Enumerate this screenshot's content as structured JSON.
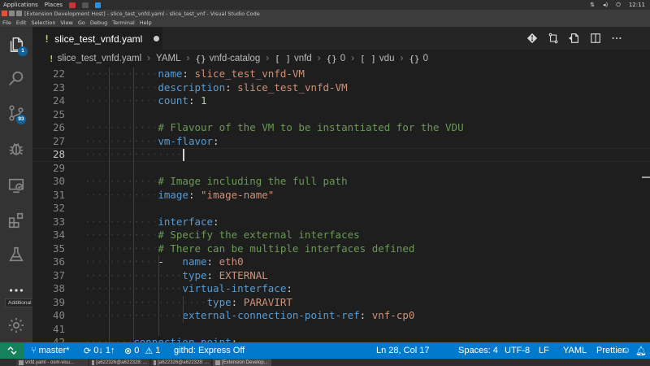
{
  "os_bar": {
    "applications": "Applications",
    "places": "Places",
    "time": "12:11"
  },
  "window": {
    "title": "[Extension Development Host] - slice_test_vnfd.yaml - slice_test_vnf - Visual Studio Code"
  },
  "menu": [
    "File",
    "Edit",
    "Selection",
    "View",
    "Go",
    "Debug",
    "Terminal",
    "Help"
  ],
  "activity_bar": {
    "explorer_badge": "1",
    "scm_badge": "93",
    "tooltip": "Additional Views"
  },
  "tab": {
    "icon": "!",
    "name": "slice_test_vnfd.yaml"
  },
  "breadcrumb": [
    {
      "icon": "!",
      "label": "slice_test_vnfd.yaml"
    },
    {
      "icon": "",
      "label": "YAML"
    },
    {
      "icon": "{}",
      "label": "vnfd-catalog"
    },
    {
      "icon": "[ ]",
      "label": "vnfd"
    },
    {
      "icon": "{}",
      "label": "0"
    },
    {
      "icon": "[ ]",
      "label": "vdu"
    },
    {
      "icon": "{}",
      "label": "0"
    }
  ],
  "editor": {
    "lines": [
      {
        "n": "22",
        "indent": 12,
        "tokens": [
          [
            "k",
            "name"
          ],
          [
            "p",
            ": "
          ],
          [
            "s",
            "slice_test_vnfd-VM"
          ]
        ]
      },
      {
        "n": "23",
        "indent": 12,
        "tokens": [
          [
            "k",
            "description"
          ],
          [
            "p",
            ": "
          ],
          [
            "s",
            "slice_test_vnfd-VM"
          ]
        ]
      },
      {
        "n": "24",
        "indent": 12,
        "tokens": [
          [
            "k",
            "count"
          ],
          [
            "p",
            ": "
          ],
          [
            "n",
            "1"
          ]
        ]
      },
      {
        "n": "25",
        "indent": 0,
        "tokens": []
      },
      {
        "n": "26",
        "indent": 12,
        "tokens": [
          [
            "c",
            "# Flavour of the VM to be instantiated for the VDU"
          ]
        ]
      },
      {
        "n": "27",
        "indent": 12,
        "tokens": [
          [
            "k",
            "vm-flavor"
          ],
          [
            "p",
            ":"
          ]
        ]
      },
      {
        "n": "28",
        "indent": 16,
        "tokens": []
      },
      {
        "n": "29",
        "indent": 0,
        "tokens": []
      },
      {
        "n": "30",
        "indent": 12,
        "tokens": [
          [
            "c",
            "# Image including the full path"
          ]
        ]
      },
      {
        "n": "31",
        "indent": 12,
        "tokens": [
          [
            "k",
            "image"
          ],
          [
            "p",
            ": "
          ],
          [
            "s",
            "\"image-name\""
          ]
        ]
      },
      {
        "n": "32",
        "indent": 0,
        "tokens": []
      },
      {
        "n": "33",
        "indent": 12,
        "tokens": [
          [
            "k",
            "interface"
          ],
          [
            "p",
            ":"
          ]
        ]
      },
      {
        "n": "34",
        "indent": 12,
        "tokens": [
          [
            "c",
            "# Specify the external interfaces"
          ]
        ]
      },
      {
        "n": "35",
        "indent": 12,
        "tokens": [
          [
            "c",
            "# There can be multiple interfaces defined"
          ]
        ]
      },
      {
        "n": "36",
        "indent": 12,
        "tokens": [
          [
            "p",
            "-   "
          ],
          [
            "k",
            "name"
          ],
          [
            "p",
            ": "
          ],
          [
            "s",
            "eth0"
          ]
        ]
      },
      {
        "n": "37",
        "indent": 16,
        "tokens": [
          [
            "k",
            "type"
          ],
          [
            "p",
            ": "
          ],
          [
            "s",
            "EXTERNAL"
          ]
        ]
      },
      {
        "n": "38",
        "indent": 16,
        "tokens": [
          [
            "k",
            "virtual-interface"
          ],
          [
            "p",
            ":"
          ]
        ]
      },
      {
        "n": "39",
        "indent": 20,
        "tokens": [
          [
            "k",
            "type"
          ],
          [
            "p",
            ": "
          ],
          [
            "s",
            "PARAVIRT"
          ]
        ]
      },
      {
        "n": "40",
        "indent": 16,
        "tokens": [
          [
            "k",
            "external-connection-point-ref"
          ],
          [
            "p",
            ": "
          ],
          [
            "s",
            "vnf-cp0"
          ]
        ]
      },
      {
        "n": "41",
        "indent": 0,
        "tokens": []
      },
      {
        "n": "42",
        "indent": 8,
        "tokens": [
          [
            "k",
            "connection-point"
          ],
          [
            "p",
            ":"
          ]
        ]
      }
    ]
  },
  "status_bar": {
    "branch": "master*",
    "sync": "0↓ 1↑",
    "errors": "0",
    "warnings": "1",
    "githd": "githd: Express Off",
    "position": "Ln 28, Col 17",
    "spaces": "Spaces: 4",
    "encoding": "UTF-8",
    "eol": "LF",
    "language": "YAML",
    "formatter": "Prettier"
  },
  "taskbar": [
    "vnfd.yaml - osm-visu...",
    "[a622326@a622328: ...",
    "[a622326@a622328: ...",
    "[Extension Develop..."
  ],
  "colors": {
    "accent": "#007acc",
    "remote": "#16825d",
    "badge": "#0e639c"
  }
}
